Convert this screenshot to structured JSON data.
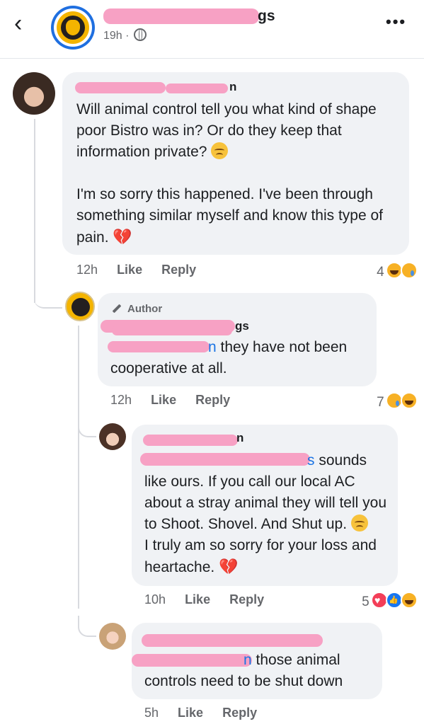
{
  "header": {
    "back_glyph": "‹",
    "page_name_suffix": "gs",
    "meta": "19h ·",
    "more_glyph": "•••",
    "icons": [
      "back-arrow-icon",
      "globe-icon",
      "more-icon"
    ]
  },
  "comments": [
    {
      "name_suffix": "n",
      "text_1": "Will animal control tell you what kind of shape poor Bistro was in?  Or do they keep that information private?",
      "text_2": "I'm so sorry this happened.  I've been through something similar myself and know this type of pain.",
      "time": "12h",
      "like": "Like",
      "reply": "Reply",
      "reaction_count": "4",
      "reactions": [
        "haha",
        "care"
      ]
    },
    {
      "badge": "Author",
      "name_suffix": "gs",
      "mention_suffix": "n",
      "text": "they have not been cooperative at all.",
      "time": "12h",
      "like": "Like",
      "reply": "Reply",
      "reaction_count": "7",
      "reactions": [
        "care",
        "haha"
      ]
    },
    {
      "name_suffix": "n",
      "mention_suffix": "s",
      "text_1": "sounds",
      "text_2": "like ours.  If you call our local AC about a stray animal they will tell you to Shoot. Shovel. And Shut up.",
      "text_3": "I truly am so sorry for your loss and heartache.",
      "time": "10h",
      "like": "Like",
      "reply": "Reply",
      "reaction_count": "5",
      "reactions": [
        "love",
        "like",
        "haha"
      ]
    },
    {
      "mention_suffix": "n",
      "text": "those animal controls need to be shut down",
      "time": "5h",
      "like": "Like",
      "reply": "Reply"
    }
  ],
  "colors": {
    "accent": "#1b74e4",
    "bubble": "#f0f2f5",
    "redaction": "#f7a1c4"
  }
}
